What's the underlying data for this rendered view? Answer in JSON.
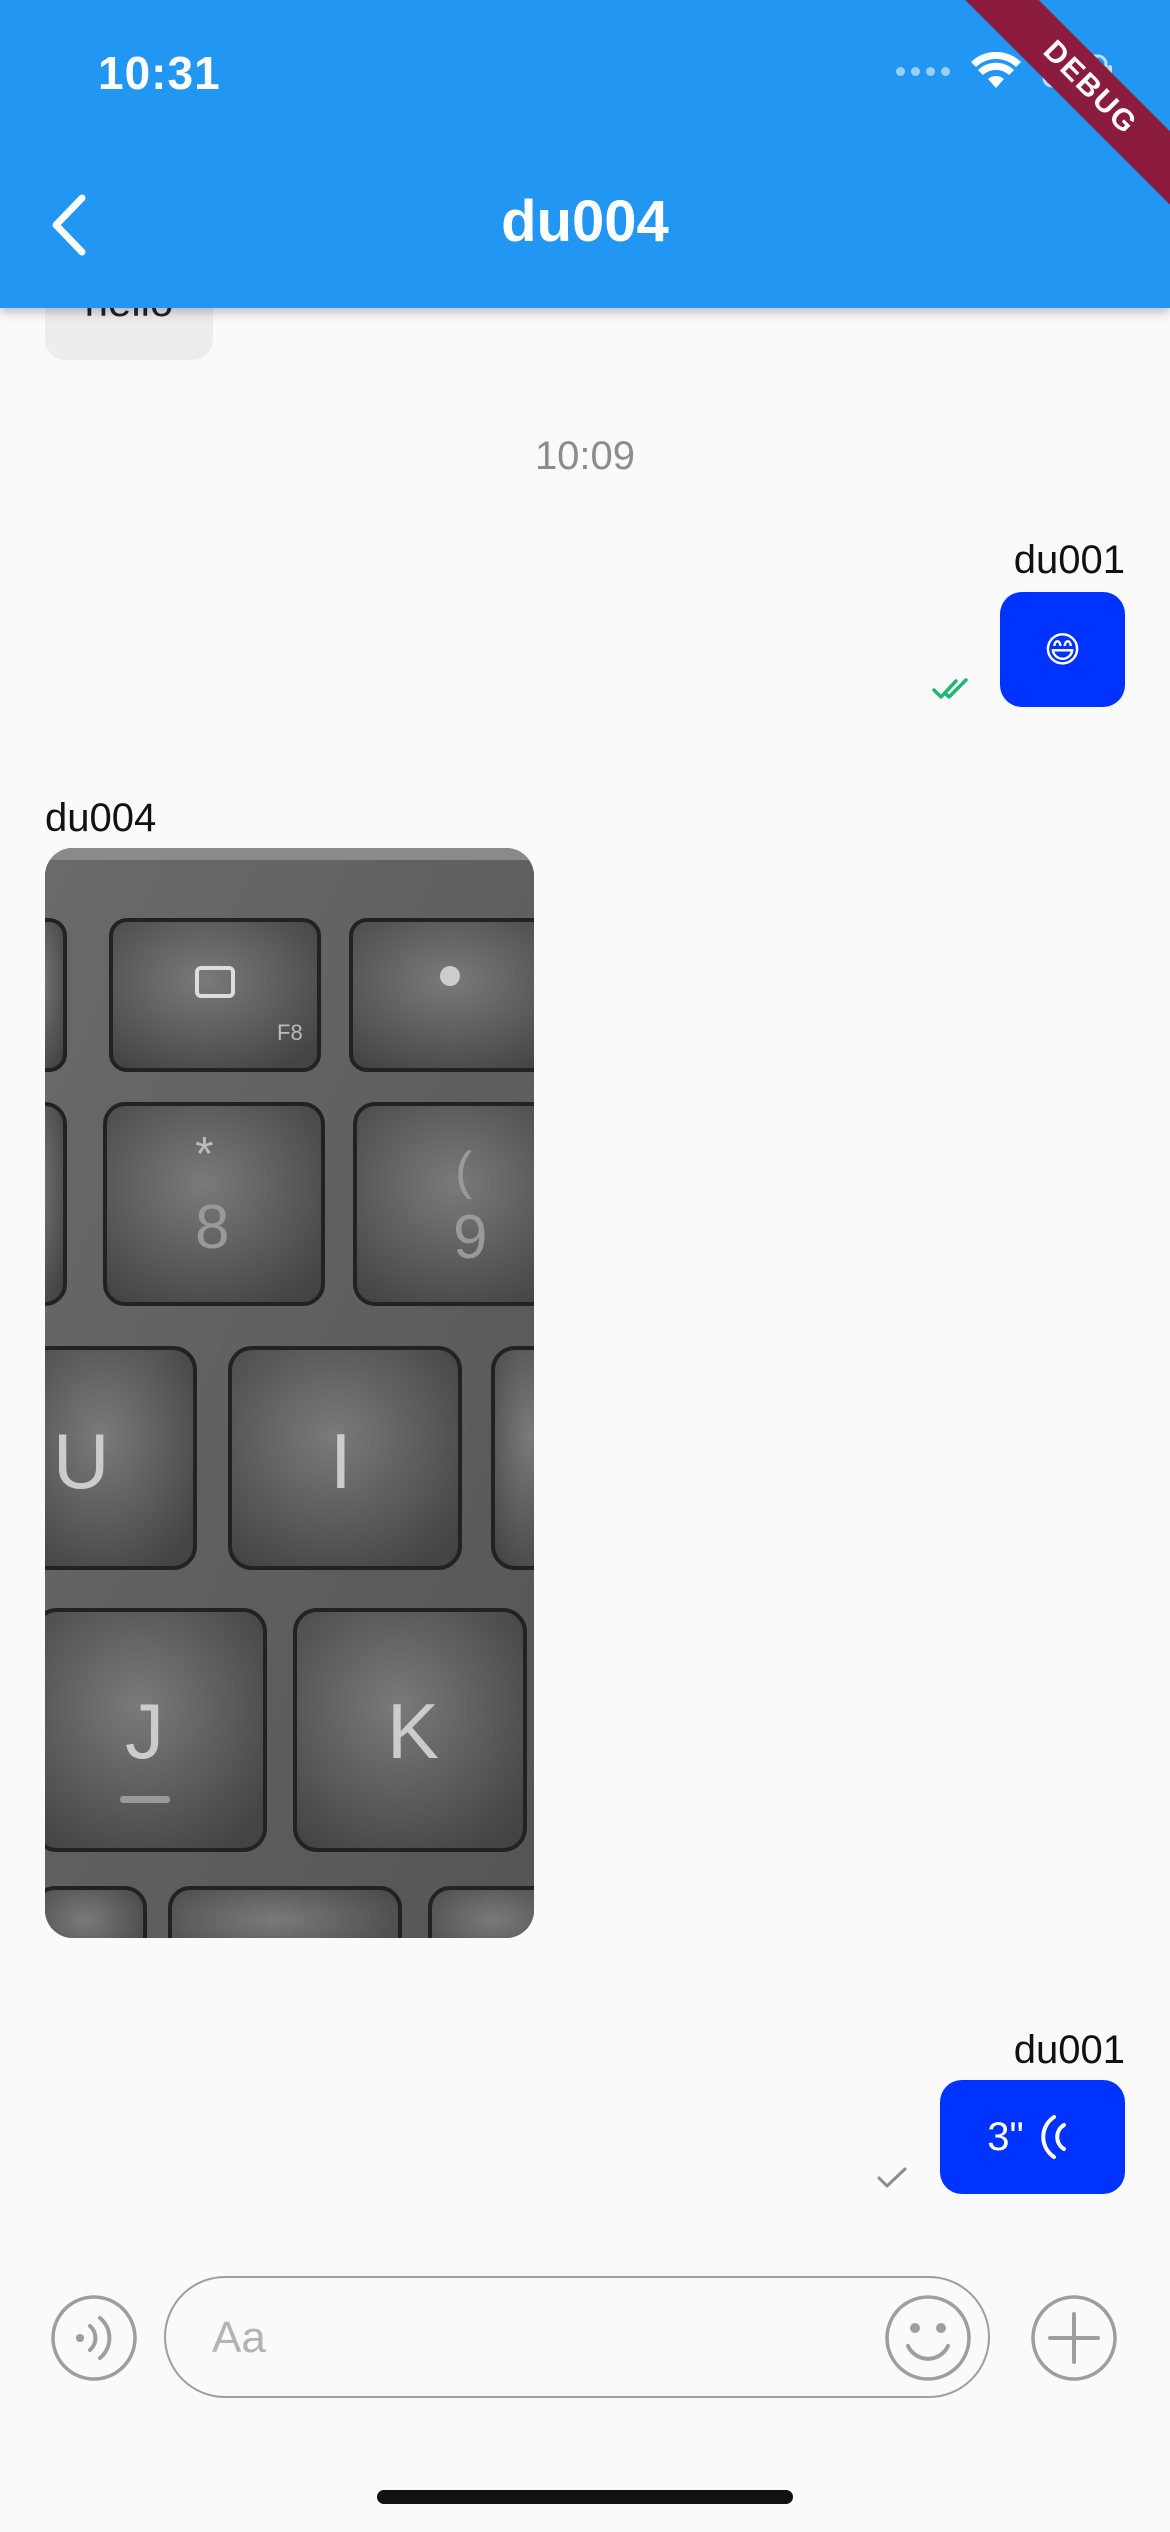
{
  "status_bar": {
    "time": "10:31"
  },
  "app_bar": {
    "title": "du004",
    "debug_banner": "DEBUG"
  },
  "messages": {
    "partial_text": "hello",
    "timestamp": "10:09",
    "emoji_message": {
      "sender": "du001",
      "content": "😄",
      "status": "read"
    },
    "image_message": {
      "sender": "du004",
      "image": "keyboard-photo"
    },
    "voice_message": {
      "sender": "du001",
      "duration": "3\"",
      "status": "sent"
    }
  },
  "input_bar": {
    "placeholder": "Aa"
  },
  "colors": {
    "app_bar": "#2196f3",
    "outgoing_bubble": "#0033ff",
    "read_check": "#22b573",
    "sent_check": "#8c8c8c",
    "debug_banner": "#8b1c3e"
  },
  "icons": [
    "back-icon",
    "wifi-icon",
    "battery-icon",
    "double-check-icon",
    "check-icon",
    "voice-wave-icon",
    "voice-input-icon",
    "emoji-icon",
    "plus-icon"
  ]
}
